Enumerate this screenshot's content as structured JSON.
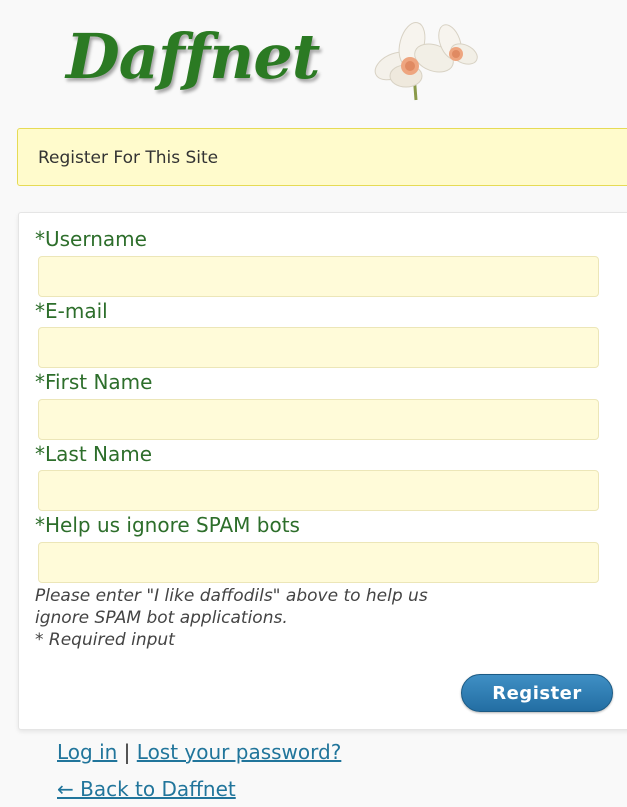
{
  "header": {
    "logo_text": "Daffnet"
  },
  "message": {
    "text": "Register For This Site"
  },
  "form": {
    "fields": [
      {
        "label": "*Username",
        "value": ""
      },
      {
        "label": "*E-mail",
        "value": ""
      },
      {
        "label": "*First Name",
        "value": ""
      },
      {
        "label": "*Last Name",
        "value": ""
      },
      {
        "label": "*Help us ignore SPAM bots",
        "value": ""
      }
    ],
    "hint_line1": "Please enter \"I like daffodils\" above to help us",
    "hint_line2": "ignore SPAM bot applications.",
    "required_note": "* Required input",
    "register_label": "Register"
  },
  "footer": {
    "login_label": "Log in",
    "separator": "|",
    "lost_password_label": "Lost your password?",
    "back_label": "← Back to Daffnet"
  },
  "colors": {
    "logo_green": "#2b7a23",
    "label_green": "#2d6e2b",
    "input_bg": "#fffbd9",
    "message_bg": "#fffbcc",
    "button_blue": "#236ea3",
    "link_blue": "#21759b"
  }
}
